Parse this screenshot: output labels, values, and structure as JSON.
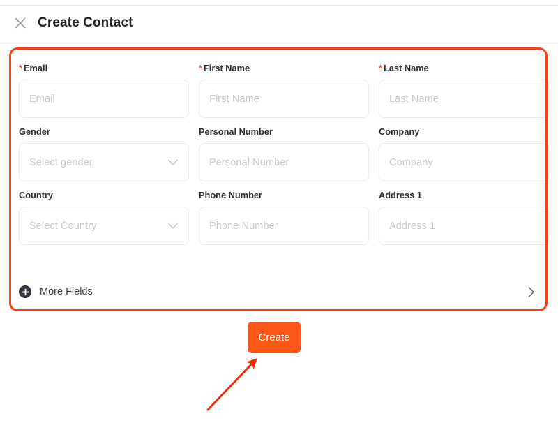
{
  "window": {
    "title": "Create Contact",
    "close_icon": "close-icon"
  },
  "colors": {
    "accent_orange": "#fc5716",
    "annotation_red": "#f93f14",
    "required_star": "#f4502a",
    "label_text": "#2a2d34",
    "placeholder_text": "#c8c9cd",
    "input_border": "#ececee"
  },
  "form": {
    "fields": [
      {
        "label": "Email",
        "required": true,
        "placeholder": "Email",
        "type": "text",
        "name": "email"
      },
      {
        "label": "First Name",
        "required": true,
        "placeholder": "First Name",
        "type": "text",
        "name": "first-name"
      },
      {
        "label": "Last Name",
        "required": true,
        "placeholder": "Last Name",
        "type": "text",
        "name": "last-name"
      },
      {
        "label": "Gender",
        "required": false,
        "placeholder": "Select gender",
        "type": "select",
        "name": "gender"
      },
      {
        "label": "Personal Number",
        "required": false,
        "placeholder": "Personal Number",
        "type": "text",
        "name": "personal-number"
      },
      {
        "label": "Company",
        "required": false,
        "placeholder": "Company",
        "type": "text",
        "name": "company"
      },
      {
        "label": "Country",
        "required": false,
        "placeholder": "Select Country",
        "type": "select",
        "name": "country"
      },
      {
        "label": "Phone Number",
        "required": false,
        "placeholder": "Phone Number",
        "type": "text",
        "name": "phone-number"
      },
      {
        "label": "Address 1",
        "required": false,
        "placeholder": "Address 1",
        "type": "text",
        "name": "address-1"
      }
    ],
    "more_fields": {
      "label": "More Fields",
      "plus_icon": "plus-circle-icon",
      "expand_icon": "chevron-right-icon"
    },
    "required_marker": "*"
  },
  "actions": {
    "create_label": "Create"
  },
  "annotations": {
    "highlight_box": "red-rounded-rectangle-around-form",
    "arrow": "red-arrow-pointing-to-create-button"
  }
}
